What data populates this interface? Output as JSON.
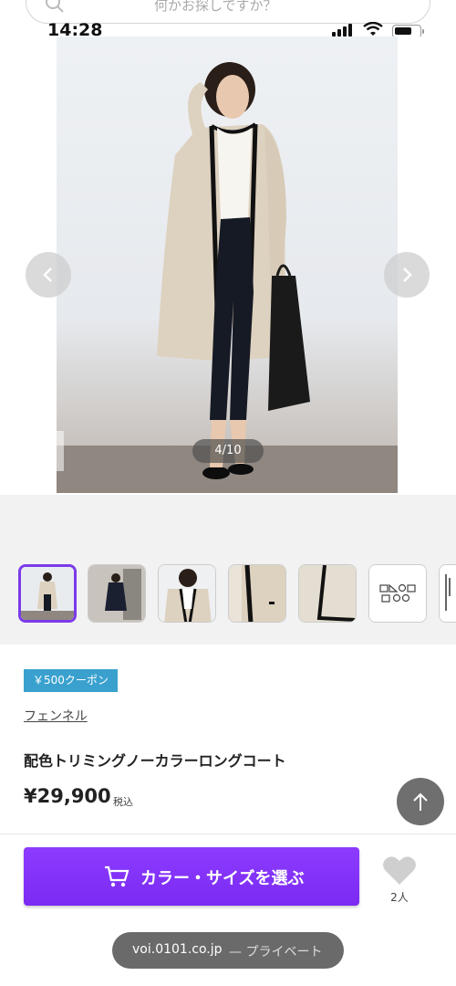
{
  "search": {
    "placeholder": "何かお探しですか？"
  },
  "status_bar": {
    "time": "14:28"
  },
  "gallery": {
    "counter": "4/10",
    "current_index": 4,
    "total": 10
  },
  "thumbnails": [
    {
      "subject": "model-full-front",
      "selected": true
    },
    {
      "subject": "model-indoor"
    },
    {
      "subject": "model-upper-closeup"
    },
    {
      "subject": "coat-detail-trim"
    },
    {
      "subject": "coat-hem-detail"
    },
    {
      "subject": "care-label-icons"
    },
    {
      "subject": "size-chart"
    }
  ],
  "product": {
    "coupon": "￥500クーポン",
    "brand": "フェンネル",
    "name": "配色トリミングノーカラーロングコート",
    "price": "¥29,900",
    "tax_label": "税込"
  },
  "actions": {
    "select_label": "カラー・サイズを選ぶ",
    "favorite_count": "2人"
  },
  "browser": {
    "domain": "voi.0101.co.jp",
    "privacy": "— プライベート"
  },
  "colors": {
    "accent_purple": "#7c3be9",
    "coupon_blue": "#3aa1cf",
    "scroll_top_gray": "#6f6f6f"
  }
}
